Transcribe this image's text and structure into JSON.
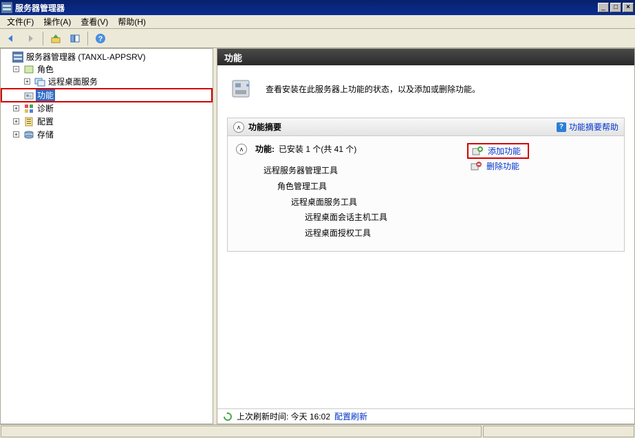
{
  "window": {
    "title": "服务器管理器"
  },
  "menu": {
    "file": "文件(F)",
    "action": "操作(A)",
    "view": "查看(V)",
    "help": "帮助(H)"
  },
  "tree": {
    "root": "服务器管理器 (TANXL-APPSRV)",
    "roles": "角色",
    "rds": "远程桌面服务",
    "features": "功能",
    "diagnostics": "诊断",
    "configuration": "配置",
    "storage": "存储"
  },
  "right": {
    "header": "功能",
    "intro": "查看安装在此服务器上功能的状态，以及添加或删除功能。",
    "panel_title": "功能摘要",
    "help_link": "功能摘要帮助",
    "summary_label": "功能:",
    "summary_value": "已安装 1 个(共 41 个)",
    "installed": {
      "i1": "远程服务器管理工具",
      "i2": "角色管理工具",
      "i3": "远程桌面服务工具",
      "i4a": "远程桌面会话主机工具",
      "i4b": "远程桌面授权工具"
    },
    "add": "添加功能",
    "remove": "删除功能",
    "refresh_label": "上次刷新时间: 今天 16:02",
    "refresh_link": "配置刷新"
  }
}
